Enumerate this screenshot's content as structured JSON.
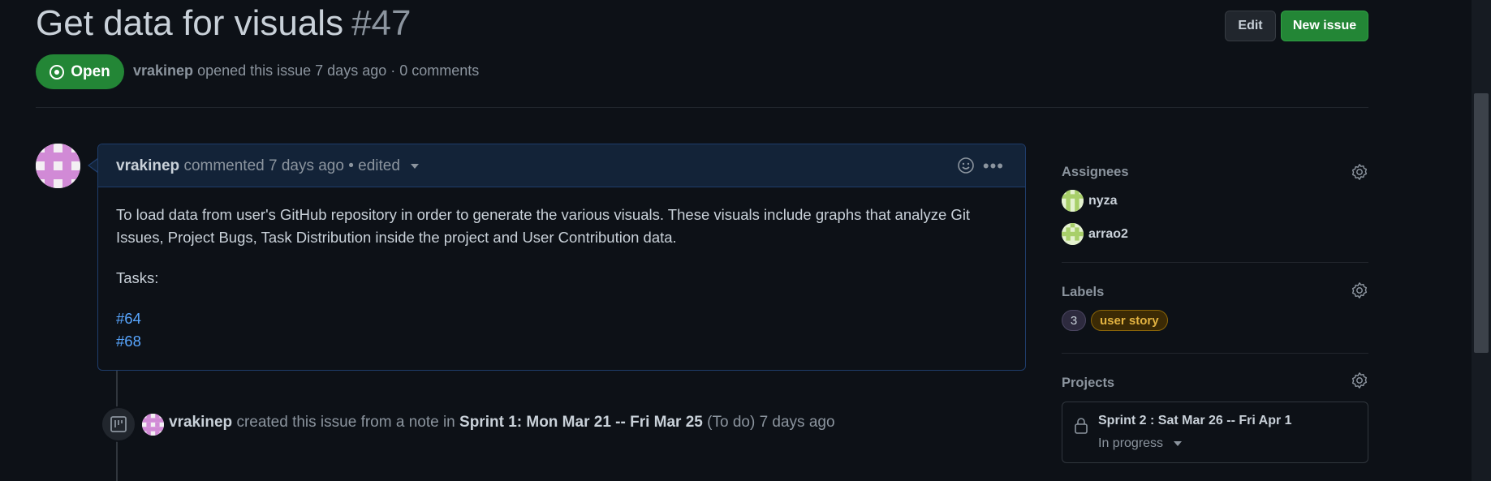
{
  "issue": {
    "title": "Get data for visuals",
    "number": "#47",
    "state": "Open",
    "author": "vrakinep",
    "opened_text": "opened this issue 7 days ago · 0 comments"
  },
  "header_buttons": {
    "edit": "Edit",
    "new_issue": "New issue"
  },
  "comment": {
    "author": "vrakinep",
    "meta": "commented 7 days ago • edited",
    "body": "To load data from user's GitHub repository in order to generate the various visuals. These visuals include graphs that analyze Git Issues, Project Bugs, Task Distribution inside the project and User Contribution data.",
    "tasks_label": "Tasks:",
    "task_links": [
      "#64",
      "#68"
    ]
  },
  "timeline_event": {
    "author": "vrakinep",
    "text1": "created this issue from a note in",
    "project": "Sprint 1: Mon Mar 21 -- Fri Mar 25",
    "column": "(To do)",
    "time": "7 days ago"
  },
  "sidebar": {
    "assignees": {
      "heading": "Assignees",
      "items": [
        "nyza",
        "arrao2"
      ]
    },
    "labels": {
      "heading": "Labels",
      "items": [
        {
          "name": "3",
          "color": "#2d2a3e"
        },
        {
          "name": "user story",
          "color": "#e3b341"
        }
      ]
    },
    "projects": {
      "heading": "Projects",
      "project_name": "Sprint 2 : Sat Mar 26 -- Fri Apr 1",
      "status": "In progress"
    }
  },
  "colors": {
    "background": "#0d1117",
    "open_state": "#238636",
    "link": "#58a6ff",
    "comment_border": "#1f3d6b"
  }
}
